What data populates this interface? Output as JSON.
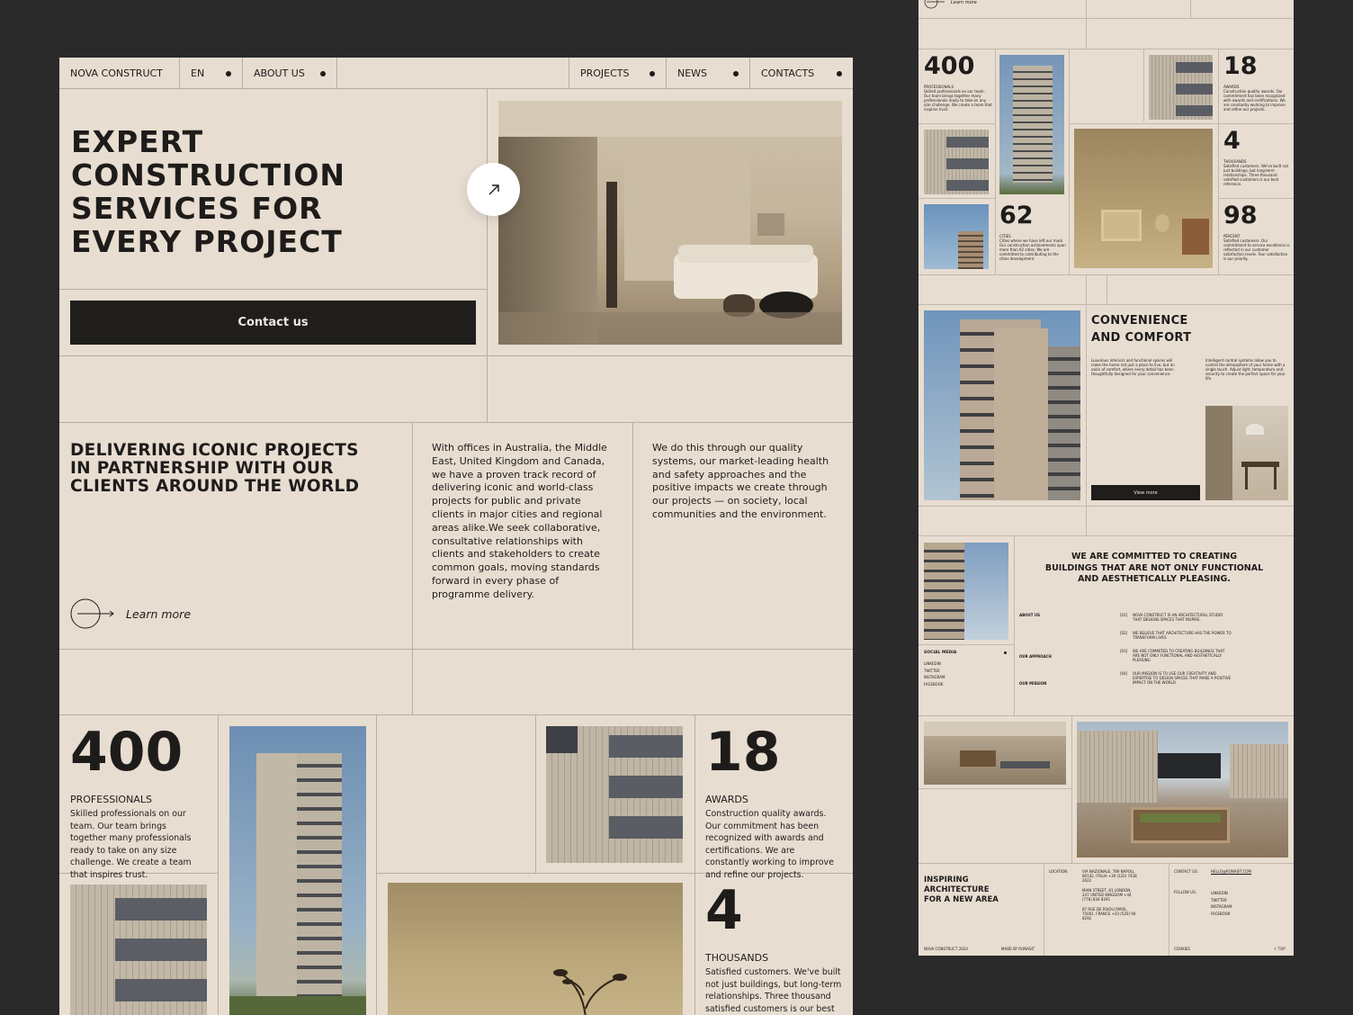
{
  "nav": {
    "brand": "NOVA CONSTRUCT",
    "lang": "EN",
    "about": "ABOUT US",
    "projects": "PROJECTS",
    "news": "NEWS",
    "contacts": "CONTACTS"
  },
  "hero": {
    "title_l1": "EXPERT",
    "title_l2": "CONSTRUCTION",
    "title_l3": "SERVICES FOR",
    "title_l4": "EVERY PROJECT",
    "cta": "Contact us"
  },
  "about": {
    "heading_l1": "DELIVERING ICONIC PROJECTS",
    "heading_l2": "IN PARTNERSHIP WITH OUR",
    "heading_l3": "CLIENTS AROUND THE WORLD",
    "learn_more": "Learn more",
    "col1": "With offices in Australia, the Middle East, United Kingdom and Canada, we have a proven track record of delivering iconic and world-class projects for public and private clients in major cities and regional areas alike.We seek collaborative, consultative relationships with clients and stakeholders to create common goals, moving standards forward in every phase of programme delivery.",
    "col2": "We do this through our quality systems, our market-leading health and safety approaches and the positive impacts we create through our projects — on society, local communities and the environment."
  },
  "stats": [
    {
      "num": "400",
      "label": "PROFESSIONALS",
      "text": "Skilled professionals on our team. Our team brings together many professionals ready to take on any size challenge. We create a team that inspires trust."
    },
    {
      "num": "18",
      "label": "AWARDS",
      "text": "Construction quality awards. Our commitment has been recognized with awards and certifications. We are constantly working to improve and refine our projects."
    },
    {
      "num": "4",
      "label": "THOUSANDS",
      "text": "Satisfied customers. We've built not just buildings, but long-term relationships. Three thousand satisfied customers is our best"
    },
    {
      "num": "62",
      "label": "CITIES",
      "text": "Cities where we have left our mark. Our construction achievements span more than 62 cities. We are committed to contributing to the cities development."
    },
    {
      "num": "98",
      "label": "PERCENT",
      "text": "Satisfied customers. Our commitment to service excellence is reflected in our customer satisfaction levels. Your satisfaction is our priority."
    }
  ],
  "right": {
    "learn_more": "Learn more",
    "stat4_text": "Satisfied customers. We've built not just buildings, but long-term relationships. Three thousand satisfied customers is our best reference.",
    "comfort_l1": "CONVENIENCE",
    "comfort_l2": "AND COMFORT",
    "comfort_a": "Luxurious interiors and functional spaces will make the home not just a place to live, but an oasis of comfort, where every detail has been thoughtfully designed for your convenience.",
    "comfort_b": "Intelligent control systems allow you to control the atmosphere of your home with a single touch. Adjust light, temperature and security to create the perfect space for your life.",
    "view_more": "View more",
    "commit_l1": "WE ARE COMMITTED TO CREATING",
    "commit_l2": "BUILDINGS THAT ARE NOT ONLY FUNCTIONAL",
    "commit_l3": "AND AESTHETICALLY PLEASING.",
    "social_title": "SOCIAL MEDIA",
    "social": [
      "LINKEDIN",
      "TWITTER",
      "INSTAGRAM",
      "FACEBOOK"
    ],
    "about_us": "ABOUT US",
    "our_approach": "OUR APPROACH",
    "our_mission": "OUR MISSION",
    "items": [
      {
        "n": "[01]",
        "t": "NOVA CONSTRUCT IS AN ARCHITECTURAL STUDIO THAT DESIGNS SPACES THAT INSPIRE."
      },
      {
        "n": "[02]",
        "t": "WE BELIEVE THAT ARCHITECTURE HAS THE POWER TO TRANSFORM LIVES"
      },
      {
        "n": "[03]",
        "t": "WE ARE COMMITED TO CREATING BUILDINGS THAT ARE NOT ONLY FUNCTIONAL AND AESTHETICALLY PLEASING"
      },
      {
        "n": "[04]",
        "t": "OUR MISSION IS TO USE OUR CREATIVITY AND EXPERTISE TO DESIGN SPACES THAT MAKE A POSITIVE IMPACT ON THE WORLD"
      }
    ],
    "footer_l1": "INSPIRING",
    "footer_l2": "ARCHITECTURE",
    "footer_l3": "FOR A NEW AREA",
    "location": "LOCATION",
    "addr1": "VIA NAZIONALE, 789 NAPOLI, 80142, ITALIA +39 (120) 7428 2622",
    "addr2": "MAIN STREET, 81 LONDON, 247 UNITED KINGDOM +44 (778) 834 8291",
    "addr3": "87 RUE DE RIVOLI PARIS, 75001, FRANCE +33 (520) 94 8292",
    "contact_us": "CONTACT US:",
    "email": "HELLO@RONASIT.COM",
    "follow_us": "FOLLOW US:",
    "copyright": "NOVA CONSTRUCT 2024",
    "made_by": "MADE BY RONASIT",
    "cookies": "COOKIES",
    "top": "↑ TOP"
  }
}
